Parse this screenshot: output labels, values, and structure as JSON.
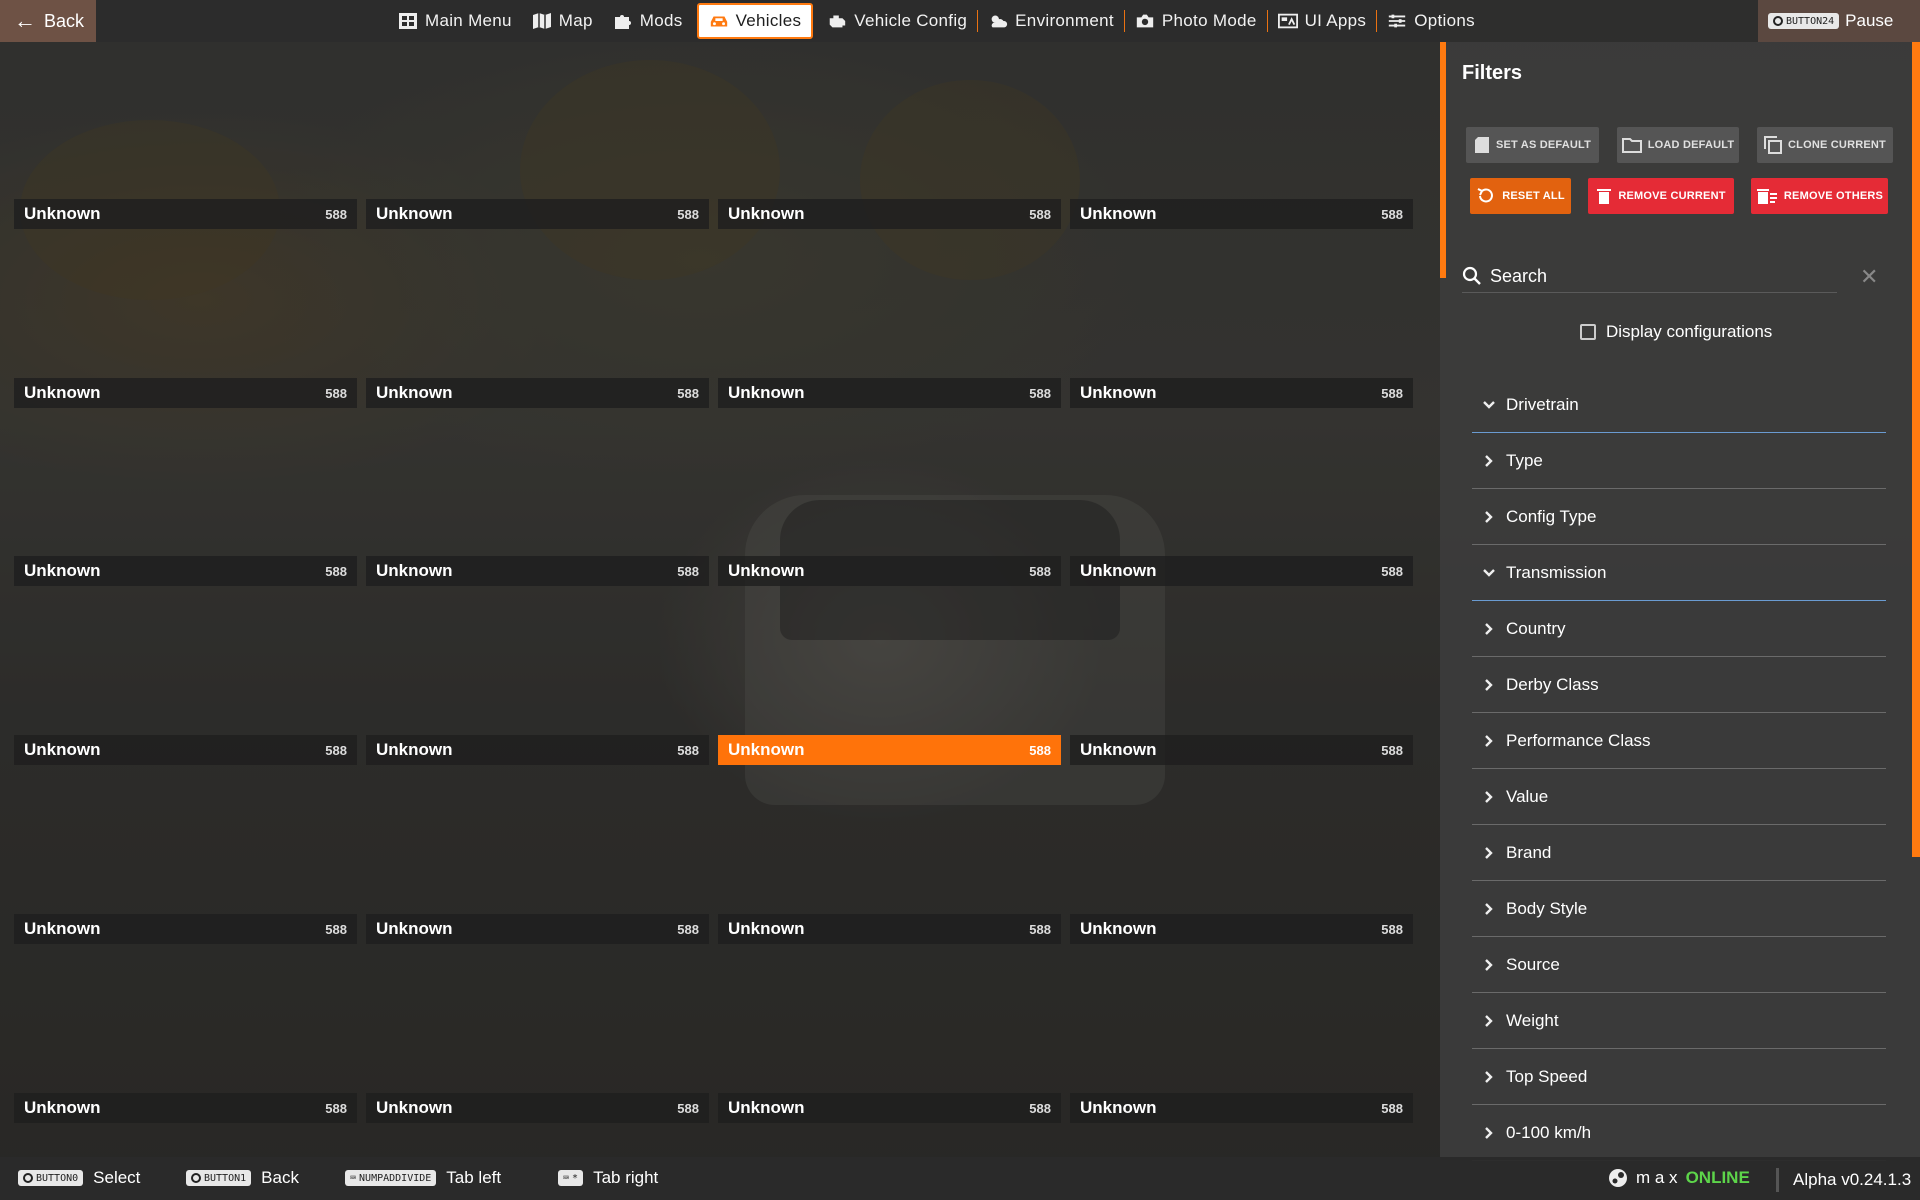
{
  "topbar": {
    "back_label": "Back",
    "nav": [
      {
        "label": "Main Menu",
        "icon": "main-menu-icon",
        "active": false
      },
      {
        "label": "Map",
        "icon": "map-icon",
        "active": false
      },
      {
        "label": "Mods",
        "icon": "puzzle-icon",
        "active": false
      },
      {
        "label": "Vehicles",
        "icon": "car-icon",
        "active": true
      },
      {
        "label": "Vehicle Config",
        "icon": "engine-icon",
        "active": false
      },
      {
        "label": "Environment",
        "icon": "weather-icon",
        "active": false
      },
      {
        "label": "Photo Mode",
        "icon": "camera-icon",
        "active": false
      },
      {
        "label": "UI Apps",
        "icon": "apps-icon",
        "active": false
      },
      {
        "label": "Options",
        "icon": "sliders-icon",
        "active": false
      }
    ],
    "pause_key": "BUTTON24",
    "pause_label": "Pause"
  },
  "vehicles": {
    "tiles": [
      {
        "name": "Unknown",
        "count": "588"
      },
      {
        "name": "Unknown",
        "count": "588"
      },
      {
        "name": "Unknown",
        "count": "588"
      },
      {
        "name": "Unknown",
        "count": "588"
      },
      {
        "name": "Unknown",
        "count": "588"
      },
      {
        "name": "Unknown",
        "count": "588"
      },
      {
        "name": "Unknown",
        "count": "588"
      },
      {
        "name": "Unknown",
        "count": "588"
      },
      {
        "name": "Unknown",
        "count": "588"
      },
      {
        "name": "Unknown",
        "count": "588"
      },
      {
        "name": "Unknown",
        "count": "588"
      },
      {
        "name": "Unknown",
        "count": "588"
      },
      {
        "name": "Unknown",
        "count": "588"
      },
      {
        "name": "Unknown",
        "count": "588"
      },
      {
        "name": "Unknown",
        "count": "588"
      },
      {
        "name": "Unknown",
        "count": "588"
      },
      {
        "name": "Unknown",
        "count": "588"
      },
      {
        "name": "Unknown",
        "count": "588"
      },
      {
        "name": "Unknown",
        "count": "588"
      },
      {
        "name": "Unknown",
        "count": "588"
      },
      {
        "name": "Unknown",
        "count": "588"
      },
      {
        "name": "Unknown",
        "count": "588"
      },
      {
        "name": "Unknown",
        "count": "588"
      },
      {
        "name": "Unknown",
        "count": "588"
      }
    ],
    "selected_index": 14
  },
  "filters": {
    "title": "Filters",
    "buttons": {
      "set_default": "SET AS DEFAULT",
      "load_default": "LOAD DEFAULT",
      "clone_current": "CLONE CURRENT",
      "reset_all": "RESET ALL",
      "remove_current": "REMOVE CURRENT",
      "remove_others": "REMOVE OTHERS"
    },
    "search_placeholder": "Search",
    "display_configurations_label": "Display configurations",
    "display_configurations_checked": false,
    "items": [
      {
        "label": "Drivetrain",
        "expanded": true
      },
      {
        "label": "Type",
        "expanded": false
      },
      {
        "label": "Config Type",
        "expanded": false
      },
      {
        "label": "Transmission",
        "expanded": true
      },
      {
        "label": "Country",
        "expanded": false
      },
      {
        "label": "Derby Class",
        "expanded": false
      },
      {
        "label": "Performance Class",
        "expanded": false
      },
      {
        "label": "Value",
        "expanded": false
      },
      {
        "label": "Brand",
        "expanded": false
      },
      {
        "label": "Body Style",
        "expanded": false
      },
      {
        "label": "Source",
        "expanded": false
      },
      {
        "label": "Weight",
        "expanded": false
      },
      {
        "label": "Top Speed",
        "expanded": false
      },
      {
        "label": "0-100 km/h",
        "expanded": false
      }
    ]
  },
  "bottombar": {
    "hints": [
      {
        "key": "BUTTON0",
        "label": "Select"
      },
      {
        "key": "BUTTON1",
        "label": "Back"
      },
      {
        "key": "NUMPADDIVIDE",
        "label": "Tab left"
      },
      {
        "key": "*",
        "label": "Tab right"
      }
    ],
    "username": "m a x",
    "status": "ONLINE",
    "version": "Alpha v0.24.1.3"
  },
  "colors": {
    "accent": "#ff7a10",
    "selected_tile": "#ff730a",
    "danger": "#e52b36",
    "online": "#5dd54a"
  }
}
